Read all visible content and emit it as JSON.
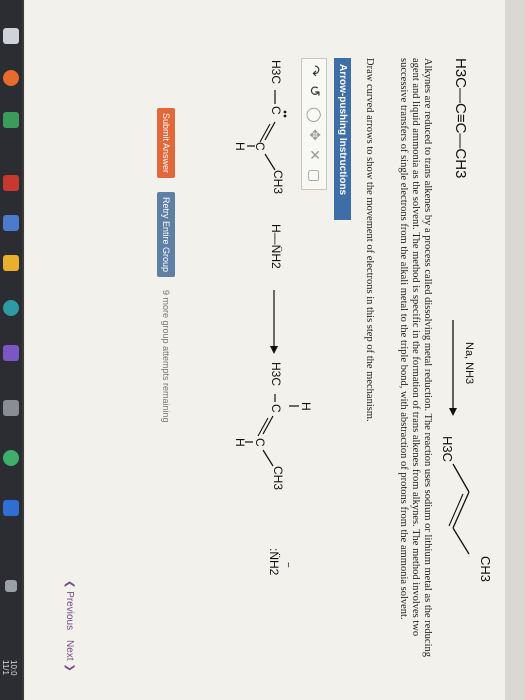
{
  "reaction": {
    "reactant": "H3C—C≡C—CH3",
    "reagents": "Na, NH3",
    "product_left": "H3C",
    "product_right": "CH3"
  },
  "description": "Alkynes are reduced to trans alkenes by a process called dissolving metal reduction. The reaction uses sodium or lithium metal as the reducing agent and liquid ammonia as the solvent. The method is specific in the formation of trans alkenes from alkynes. The method involves two successive transfers of single electrons from the alkali metal to the triple bond, with abstraction of protons from the ammonia solvent.",
  "instruction": "Draw curved arrows to show the movement of electrons in this step of the mechanism.",
  "arrow_pushing_label": "Arrow-pushing Instructions",
  "mechanism": {
    "left_ch3": "H3C",
    "c_dot": "C",
    "c2": "C",
    "ch3": "CH3",
    "h": "H",
    "nh2_pair": "H—N̈H2",
    "product_h_top": "H",
    "product_h3c": "H3C",
    "product_c1": "C",
    "product_c2": "C",
    "product_ch3": "CH3",
    "product_h_bottom": "H",
    "amide": ":N̈H2",
    "amide_charge": "−"
  },
  "buttons": {
    "submit": "Submit Answer",
    "retry": "Retry Entire Group",
    "attempts": "9 more group attempts remaining",
    "previous": "Previous",
    "next": "Next"
  },
  "taskbar": {
    "clock": "10:0",
    "date": "11/1"
  },
  "colors": {
    "blue_bar": "#3d6ea8",
    "submit_button": "#e2683c",
    "retry_button": "#5f7fa5",
    "nav_purple": "#7b4b8a",
    "taskbar": "#2b2d33"
  }
}
